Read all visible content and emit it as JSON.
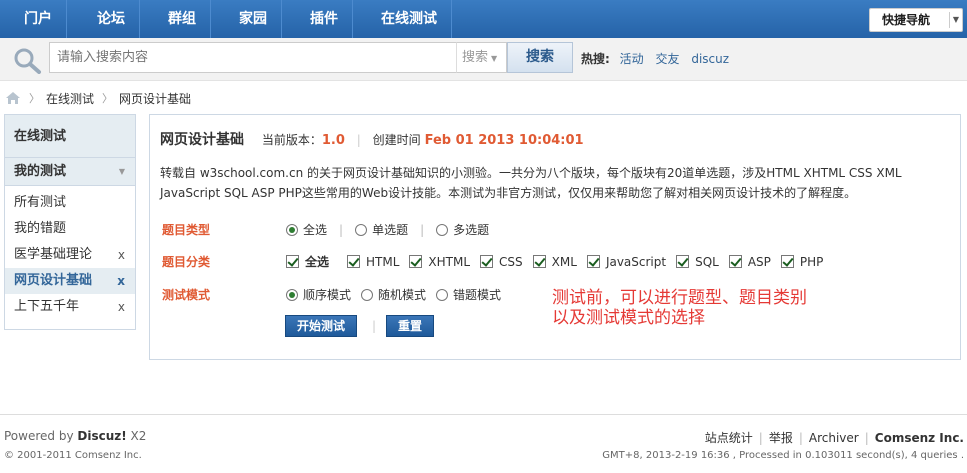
{
  "nav": {
    "items": [
      "门户",
      "论坛",
      "群组",
      "家园",
      "插件",
      "在线测试"
    ],
    "quick_nav": "快捷导航"
  },
  "search": {
    "placeholder": "请输入搜索内容",
    "type": "搜索",
    "button": "搜索",
    "hot_label": "热搜:",
    "hot_links": [
      "活动",
      "交友",
      "discuz"
    ]
  },
  "breadcrumb": {
    "items": [
      "在线测试",
      "网页设计基础"
    ]
  },
  "sidebar": {
    "head": "在线测试",
    "sub": "我的测试",
    "items": [
      {
        "label": "所有测试",
        "x": ""
      },
      {
        "label": "我的错题",
        "x": ""
      },
      {
        "label": "医学基础理论",
        "x": "x"
      },
      {
        "label": "网页设计基础",
        "x": "x"
      },
      {
        "label": "上下五千年",
        "x": "x"
      }
    ]
  },
  "main": {
    "title": "网页设计基础",
    "version_label": "当前版本：",
    "version": "1.0",
    "created_label": "创建时间",
    "created": "Feb 01 2013 10:04:01",
    "description": "转载自 w3school.com.cn 的关于网页设计基础知识的小测验。一共分为八个版块，每个版块有20道单选题，涉及HTML XHTML CSS XML JavaScript SQL ASP PHP这些常用的Web设计技能。本测试为非官方测试，仅仅用来帮助您了解对相关网页设计技术的了解程度。",
    "type_label": "题目类型",
    "type_options": [
      "全选",
      "单选题",
      "多选题"
    ],
    "category_label": "题目分类",
    "category_options": [
      "全选",
      "HTML",
      "XHTML",
      "CSS",
      "XML",
      "JavaScript",
      "SQL",
      "ASP",
      "PHP"
    ],
    "mode_label": "测试模式",
    "mode_options": [
      "顺序模式",
      "随机模式",
      "错题模式"
    ],
    "start_button": "开始测试",
    "reset_button": "重置"
  },
  "annotation": {
    "line1": "测试前，可以进行题型、题目类别",
    "line2": "以及测试模式的选择"
  },
  "footer": {
    "powered_prefix": "Powered by ",
    "powered_name": "Discuz!",
    "powered_version": " X2",
    "copyright": "© 2001-2011 Comsenz Inc.",
    "links": [
      "站点统计",
      "举报",
      "Archiver"
    ],
    "company": "Comsenz Inc.",
    "stats": "GMT+8, 2013-2-19 16:36 , Processed in 0.103011 second(s), 4 queries ."
  }
}
